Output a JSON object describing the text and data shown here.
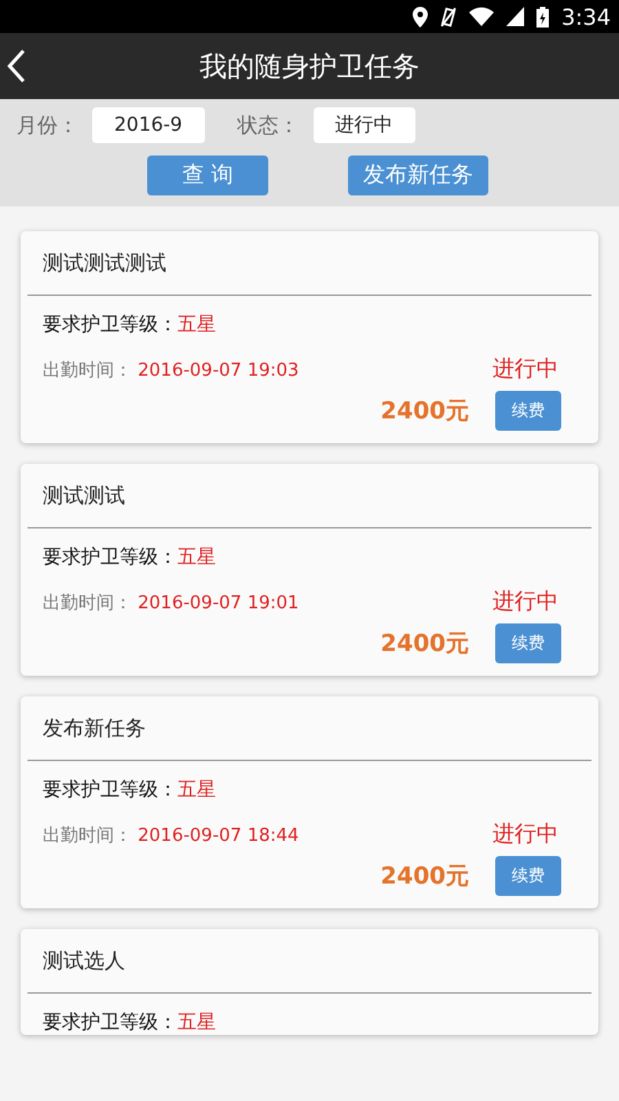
{
  "status_bar": {
    "time": "3:34"
  },
  "header": {
    "title": "我的随身护卫任务"
  },
  "filters": [
    {
      "label": "月份：",
      "value": "2016-9"
    },
    {
      "label": "状态：",
      "value": "进行中"
    }
  ],
  "actions": [
    "查 询",
    "发布新任务"
  ],
  "tasks": [
    {
      "title": "测试测试测试",
      "level_label": "要求护卫等级：",
      "level": "五星",
      "time_label": "出勤时间：",
      "time": "2016-09-07 19:03",
      "status": "进行中",
      "price": "2400元",
      "button": "续费"
    },
    {
      "title": "测试测试",
      "level_label": "要求护卫等级：",
      "level": "五星",
      "time_label": "出勤时间：",
      "time": "2016-09-07 19:01",
      "status": "进行中",
      "price": "2400元",
      "button": "续费"
    },
    {
      "title": "发布新任务",
      "level_label": "要求护卫等级：",
      "level": "五星",
      "time_label": "出勤时间：",
      "time": "2016-09-07 18:44",
      "status": "进行中",
      "price": "2400元",
      "button": "续费"
    },
    {
      "title": "测试选人",
      "level_label": "要求护卫等级：",
      "level": "五星"
    }
  ]
}
